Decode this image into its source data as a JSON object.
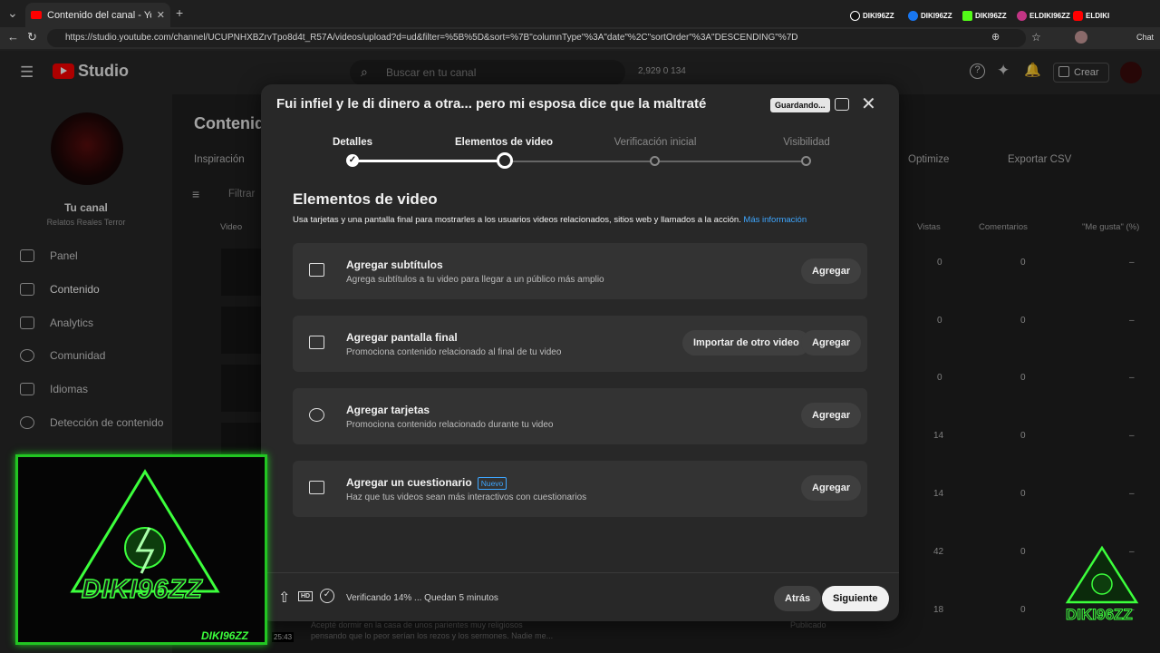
{
  "browser": {
    "tab_title": "Contenido del canal - YouTube Stu",
    "url": "https://studio.youtube.com/channel/UCUPNHXBZrvTpo8d4t_R57A/videos/upload?d=ud&filter=%5B%5D&sort=%7B\"columnType\"%3A\"date\"%2C\"sortOrder\"%3A\"DESCENDING\"%7D",
    "socials": [
      "DIKI96ZZ",
      "DIKI96ZZ",
      "DIKI96ZZ",
      "ELDIKI96ZZ",
      "ELDIKI"
    ],
    "chat_label": "Chat"
  },
  "header": {
    "logo": "Studio",
    "search_placeholder": "Buscar en tu canal",
    "stats": "2,929   0   134",
    "create_label": "Crear"
  },
  "sidebar": {
    "channel_title": "Tu canal",
    "channel_name": "Relatos Reales Terror",
    "items": [
      {
        "label": "Panel"
      },
      {
        "label": "Contenido"
      },
      {
        "label": "Analytics"
      },
      {
        "label": "Comunidad"
      },
      {
        "label": "Idiomas"
      },
      {
        "label": "Detección de contenido"
      }
    ]
  },
  "background": {
    "page_title": "Contenido",
    "tab_inspiration": "Inspiración",
    "filter_placeholder": "Filtrar",
    "col_video": "Video",
    "col_views": "Vistas",
    "col_comments": "Comentarios",
    "col_likes": "\"Me gusta\" (%)",
    "optimize": "Optimize",
    "export": "Exportar CSV",
    "rows": [
      {
        "views": "0",
        "comments": "0",
        "likes": "–"
      },
      {
        "views": "0",
        "comments": "0",
        "likes": "–"
      },
      {
        "views": "0",
        "comments": "0",
        "likes": "–"
      },
      {
        "views": "14",
        "comments": "0",
        "likes": "–"
      },
      {
        "views": "14",
        "comments": "0",
        "likes": "–"
      },
      {
        "views": "42",
        "comments": "0",
        "likes": "–"
      },
      {
        "views": "18",
        "comments": "0",
        "likes": "–"
      }
    ],
    "last_row_desc": "Acepté dormir en la casa de unos parientes muy religiosos pensando que lo peor serían los rezos y los sermones. Nadie me...",
    "last_row_status": "Publicado",
    "last_row_duration": "25:43"
  },
  "modal": {
    "title": "Fui infiel y le di dinero a otra... pero mi esposa dice que la maltraté",
    "saving_badge": "Guardando...",
    "steps": [
      {
        "label": "Detalles",
        "state": "done"
      },
      {
        "label": "Elementos de video",
        "state": "current"
      },
      {
        "label": "Verificación inicial",
        "state": "todo"
      },
      {
        "label": "Visibilidad",
        "state": "todo"
      }
    ],
    "section_title": "Elementos de video",
    "section_desc": "Usa tarjetas y una pantalla final para mostrarles a los usuarios videos relacionados, sitios web y llamados a la acción.",
    "section_link": "Más información",
    "cards": [
      {
        "title": "Agregar subtítulos",
        "subtitle": "Agrega subtítulos a tu video para llegar a un público más amplio",
        "button": "Agregar",
        "icon": "subtitles-icon"
      },
      {
        "title": "Agregar pantalla final",
        "subtitle": "Promociona contenido relacionado al final de tu video",
        "button": "Agregar",
        "secondary_button": "Importar de otro video",
        "icon": "end-screen-icon"
      },
      {
        "title": "Agregar tarjetas",
        "subtitle": "Promociona contenido relacionado durante tu video",
        "button": "Agregar",
        "icon": "info-icon"
      },
      {
        "title": "Agregar un cuestionario",
        "badge": "Nuevo",
        "subtitle": "Haz que tus videos sean más interactivos con cuestionarios",
        "button": "Agregar",
        "icon": "checkbox-icon"
      }
    ],
    "footer": {
      "status": "Verificando 14% ... Quedan 5 minutos",
      "back": "Atrás",
      "next": "Siguiente"
    }
  },
  "overlay": {
    "webcam_text": "DIKI96ZZ",
    "webcam_sub": "DIKI96ZZ",
    "corner_text": "DIKI96ZZ"
  },
  "colors": {
    "accent_blue": "#3ea6ff",
    "brand_red": "#ff0000",
    "overlay_green": "#3cff3c"
  }
}
